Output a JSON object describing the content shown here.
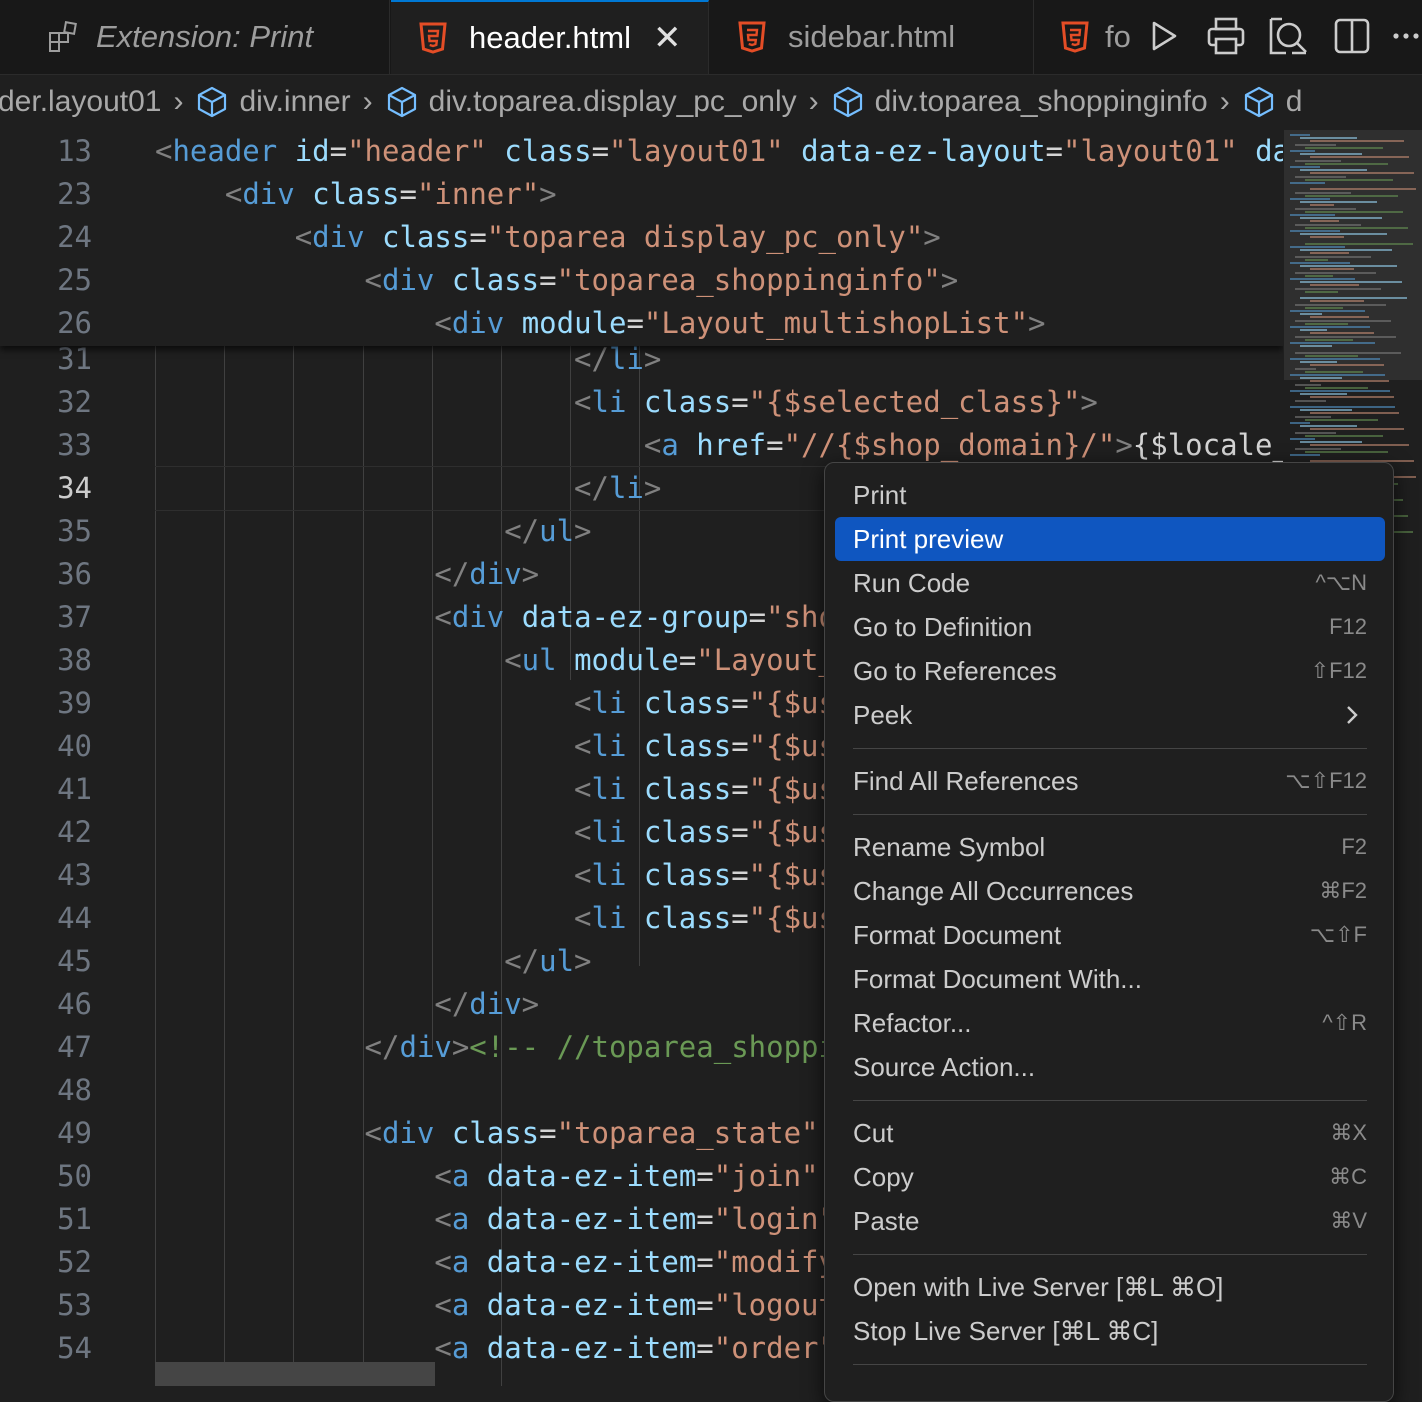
{
  "tabs": [
    {
      "label": "Extension: Print",
      "icon": "extension-preview-icon",
      "active": false
    },
    {
      "label": "header.html",
      "icon": "html5-icon",
      "active": true
    },
    {
      "label": "sidebar.html",
      "icon": "html5-icon",
      "active": false
    },
    {
      "label": "fo",
      "icon": "html5-icon",
      "active": false
    }
  ],
  "toolbar": [
    "run-icon",
    "print-icon",
    "print-preview-icon",
    "split-editor-icon",
    "more-icon"
  ],
  "breadcrumb": [
    "der.layout01",
    "div.inner",
    "div.toparea.display_pc_only",
    "div.toparea_shoppinginfo",
    "d"
  ],
  "colors": {
    "accent": "#0078d4",
    "selection": "#0f56c0",
    "tag": "#569cd6",
    "attr": "#9cdcfe",
    "string": "#ce9178",
    "comment": "#6a9955"
  },
  "sticky_lines": [
    {
      "n": "13",
      "tokens": [
        [
          "brk",
          "<"
        ],
        [
          "tag",
          "header"
        ],
        [
          "txt",
          " "
        ],
        [
          "attr",
          "id"
        ],
        [
          "eq",
          "="
        ],
        [
          "str",
          "\"header\""
        ],
        [
          "txt",
          " "
        ],
        [
          "attr",
          "class"
        ],
        [
          "eq",
          "="
        ],
        [
          "str",
          "\"layout01\""
        ],
        [
          "txt",
          " "
        ],
        [
          "attr",
          "data-ez-layout"
        ],
        [
          "eq",
          "="
        ],
        [
          "str",
          "\"layout01\""
        ],
        [
          "txt",
          " "
        ],
        [
          "attr",
          "da"
        ]
      ]
    },
    {
      "n": "23",
      "tokens": [
        [
          "txt",
          "    "
        ],
        [
          "brk",
          "<"
        ],
        [
          "tag",
          "div"
        ],
        [
          "txt",
          " "
        ],
        [
          "attr",
          "class"
        ],
        [
          "eq",
          "="
        ],
        [
          "str",
          "\"inner\""
        ],
        [
          "brk",
          ">"
        ]
      ]
    },
    {
      "n": "24",
      "tokens": [
        [
          "txt",
          "        "
        ],
        [
          "brk",
          "<"
        ],
        [
          "tag",
          "div"
        ],
        [
          "txt",
          " "
        ],
        [
          "attr",
          "class"
        ],
        [
          "eq",
          "="
        ],
        [
          "str",
          "\"toparea display_pc_only\""
        ],
        [
          "brk",
          ">"
        ]
      ]
    },
    {
      "n": "25",
      "tokens": [
        [
          "txt",
          "            "
        ],
        [
          "brk",
          "<"
        ],
        [
          "tag",
          "div"
        ],
        [
          "txt",
          " "
        ],
        [
          "attr",
          "class"
        ],
        [
          "eq",
          "="
        ],
        [
          "str",
          "\"toparea_shoppinginfo\""
        ],
        [
          "brk",
          ">"
        ]
      ]
    },
    {
      "n": "26",
      "tokens": [
        [
          "txt",
          "                "
        ],
        [
          "brk",
          "<"
        ],
        [
          "tag",
          "div"
        ],
        [
          "txt",
          " "
        ],
        [
          "attr",
          "module"
        ],
        [
          "eq",
          "="
        ],
        [
          "str",
          "\"Layout_multishopList\""
        ],
        [
          "brk",
          ">"
        ]
      ]
    }
  ],
  "lines": [
    {
      "n": "31",
      "tokens": [
        [
          "txt",
          "                        "
        ],
        [
          "brk",
          "</"
        ],
        [
          "tag",
          "li"
        ],
        [
          "brk",
          ">"
        ]
      ]
    },
    {
      "n": "32",
      "tokens": [
        [
          "txt",
          "                        "
        ],
        [
          "brk",
          "<"
        ],
        [
          "tag",
          "li"
        ],
        [
          "txt",
          " "
        ],
        [
          "attr",
          "class"
        ],
        [
          "eq",
          "="
        ],
        [
          "str",
          "\"{$selected_class}\""
        ],
        [
          "brk",
          ">"
        ]
      ]
    },
    {
      "n": "33",
      "tokens": [
        [
          "txt",
          "                            "
        ],
        [
          "brk",
          "<"
        ],
        [
          "tag",
          "a"
        ],
        [
          "txt",
          " "
        ],
        [
          "attr",
          "href"
        ],
        [
          "eq",
          "="
        ],
        [
          "str",
          "\"//{$shop_domain}/\""
        ],
        [
          "brk",
          ">"
        ],
        [
          "txt",
          "{$locale_"
        ]
      ]
    },
    {
      "n": "34",
      "tokens": [
        [
          "txt",
          "                        "
        ],
        [
          "brk",
          "</"
        ],
        [
          "tag",
          "li"
        ],
        [
          "brk",
          ">"
        ]
      ]
    },
    {
      "n": "35",
      "tokens": [
        [
          "txt",
          "                    "
        ],
        [
          "brk",
          "</"
        ],
        [
          "tag",
          "ul"
        ],
        [
          "brk",
          ">"
        ]
      ]
    },
    {
      "n": "36",
      "tokens": [
        [
          "txt",
          "                "
        ],
        [
          "brk",
          "</"
        ],
        [
          "tag",
          "div"
        ],
        [
          "brk",
          ">"
        ]
      ]
    },
    {
      "n": "37",
      "tokens": [
        [
          "txt",
          "                "
        ],
        [
          "brk",
          "<"
        ],
        [
          "tag",
          "div"
        ],
        [
          "txt",
          " "
        ],
        [
          "attr",
          "data-ez-group"
        ],
        [
          "eq",
          "="
        ],
        [
          "str",
          "\"sho"
        ]
      ]
    },
    {
      "n": "38",
      "tokens": [
        [
          "txt",
          "                    "
        ],
        [
          "brk",
          "<"
        ],
        [
          "tag",
          "ul"
        ],
        [
          "txt",
          " "
        ],
        [
          "attr",
          "module"
        ],
        [
          "eq",
          "="
        ],
        [
          "str",
          "\"Layout_"
        ]
      ]
    },
    {
      "n": "39",
      "tokens": [
        [
          "txt",
          "                        "
        ],
        [
          "brk",
          "<"
        ],
        [
          "tag",
          "li"
        ],
        [
          "txt",
          " "
        ],
        [
          "attr",
          "class"
        ],
        [
          "eq",
          "="
        ],
        [
          "str",
          "\"{$us"
        ]
      ]
    },
    {
      "n": "40",
      "tokens": [
        [
          "txt",
          "                        "
        ],
        [
          "brk",
          "<"
        ],
        [
          "tag",
          "li"
        ],
        [
          "txt",
          " "
        ],
        [
          "attr",
          "class"
        ],
        [
          "eq",
          "="
        ],
        [
          "str",
          "\"{$us"
        ]
      ]
    },
    {
      "n": "41",
      "tokens": [
        [
          "txt",
          "                        "
        ],
        [
          "brk",
          "<"
        ],
        [
          "tag",
          "li"
        ],
        [
          "txt",
          " "
        ],
        [
          "attr",
          "class"
        ],
        [
          "eq",
          "="
        ],
        [
          "str",
          "\"{$us"
        ]
      ]
    },
    {
      "n": "42",
      "tokens": [
        [
          "txt",
          "                        "
        ],
        [
          "brk",
          "<"
        ],
        [
          "tag",
          "li"
        ],
        [
          "txt",
          " "
        ],
        [
          "attr",
          "class"
        ],
        [
          "eq",
          "="
        ],
        [
          "str",
          "\"{$us"
        ]
      ]
    },
    {
      "n": "43",
      "tokens": [
        [
          "txt",
          "                        "
        ],
        [
          "brk",
          "<"
        ],
        [
          "tag",
          "li"
        ],
        [
          "txt",
          " "
        ],
        [
          "attr",
          "class"
        ],
        [
          "eq",
          "="
        ],
        [
          "str",
          "\"{$us"
        ]
      ]
    },
    {
      "n": "44",
      "tokens": [
        [
          "txt",
          "                        "
        ],
        [
          "brk",
          "<"
        ],
        [
          "tag",
          "li"
        ],
        [
          "txt",
          " "
        ],
        [
          "attr",
          "class"
        ],
        [
          "eq",
          "="
        ],
        [
          "str",
          "\"{$us"
        ]
      ]
    },
    {
      "n": "45",
      "tokens": [
        [
          "txt",
          "                    "
        ],
        [
          "brk",
          "</"
        ],
        [
          "tag",
          "ul"
        ],
        [
          "brk",
          ">"
        ]
      ]
    },
    {
      "n": "46",
      "tokens": [
        [
          "txt",
          "                "
        ],
        [
          "brk",
          "</"
        ],
        [
          "tag",
          "div"
        ],
        [
          "brk",
          ">"
        ]
      ]
    },
    {
      "n": "47",
      "tokens": [
        [
          "txt",
          "            "
        ],
        [
          "brk",
          "</"
        ],
        [
          "tag",
          "div"
        ],
        [
          "brk",
          ">"
        ],
        [
          "com",
          "<!-- //toparea_shoppi"
        ]
      ]
    },
    {
      "n": "48",
      "tokens": []
    },
    {
      "n": "49",
      "tokens": [
        [
          "txt",
          "            "
        ],
        [
          "brk",
          "<"
        ],
        [
          "tag",
          "div"
        ],
        [
          "txt",
          " "
        ],
        [
          "attr",
          "class"
        ],
        [
          "eq",
          "="
        ],
        [
          "str",
          "\"toparea_state\""
        ]
      ]
    },
    {
      "n": "50",
      "tokens": [
        [
          "txt",
          "                "
        ],
        [
          "brk",
          "<"
        ],
        [
          "tag",
          "a"
        ],
        [
          "txt",
          " "
        ],
        [
          "attr",
          "data-ez-item"
        ],
        [
          "eq",
          "="
        ],
        [
          "str",
          "\"join\""
        ]
      ]
    },
    {
      "n": "51",
      "tokens": [
        [
          "txt",
          "                "
        ],
        [
          "brk",
          "<"
        ],
        [
          "tag",
          "a"
        ],
        [
          "txt",
          " "
        ],
        [
          "attr",
          "data-ez-item"
        ],
        [
          "eq",
          "="
        ],
        [
          "str",
          "\"login\""
        ]
      ]
    },
    {
      "n": "52",
      "tokens": [
        [
          "txt",
          "                "
        ],
        [
          "brk",
          "<"
        ],
        [
          "tag",
          "a"
        ],
        [
          "txt",
          " "
        ],
        [
          "attr",
          "data-ez-item"
        ],
        [
          "eq",
          "="
        ],
        [
          "str",
          "\"modify"
        ]
      ]
    },
    {
      "n": "53",
      "tokens": [
        [
          "txt",
          "                "
        ],
        [
          "brk",
          "<"
        ],
        [
          "tag",
          "a"
        ],
        [
          "txt",
          " "
        ],
        [
          "attr",
          "data-ez-item"
        ],
        [
          "eq",
          "="
        ],
        [
          "str",
          "\"logout"
        ]
      ]
    },
    {
      "n": "54",
      "tokens": [
        [
          "txt",
          "                "
        ],
        [
          "brk",
          "<"
        ],
        [
          "tag",
          "a"
        ],
        [
          "txt",
          " "
        ],
        [
          "attr",
          "data-ez-item"
        ],
        [
          "eq",
          "="
        ],
        [
          "str",
          "\"order\""
        ]
      ]
    }
  ],
  "active_line": "34",
  "context_menu": {
    "items": [
      {
        "label": "Print",
        "shortcut": ""
      },
      {
        "label": "Print preview",
        "shortcut": "",
        "selected": true
      },
      {
        "label": "Run Code",
        "shortcut": "^⌥N"
      },
      {
        "label": "Go to Definition",
        "shortcut": "F12"
      },
      {
        "label": "Go to References",
        "shortcut": "⇧F12"
      },
      {
        "label": "Peek",
        "shortcut": "",
        "submenu": true
      },
      {
        "separator": true
      },
      {
        "label": "Find All References",
        "shortcut": "⌥⇧F12"
      },
      {
        "separator": true
      },
      {
        "label": "Rename Symbol",
        "shortcut": "F2"
      },
      {
        "label": "Change All Occurrences",
        "shortcut": "⌘F2"
      },
      {
        "label": "Format Document",
        "shortcut": "⌥⇧F"
      },
      {
        "label": "Format Document With...",
        "shortcut": ""
      },
      {
        "label": "Refactor...",
        "shortcut": "^⇧R"
      },
      {
        "label": "Source Action...",
        "shortcut": ""
      },
      {
        "separator": true
      },
      {
        "label": "Cut",
        "shortcut": "⌘X"
      },
      {
        "label": "Copy",
        "shortcut": "⌘C"
      },
      {
        "label": "Paste",
        "shortcut": "⌘V"
      },
      {
        "separator": true
      },
      {
        "label": "Open with Live Server [⌘L ⌘O]",
        "shortcut": ""
      },
      {
        "label": "Stop Live Server [⌘L ⌘C]",
        "shortcut": ""
      },
      {
        "separator": true
      }
    ]
  }
}
